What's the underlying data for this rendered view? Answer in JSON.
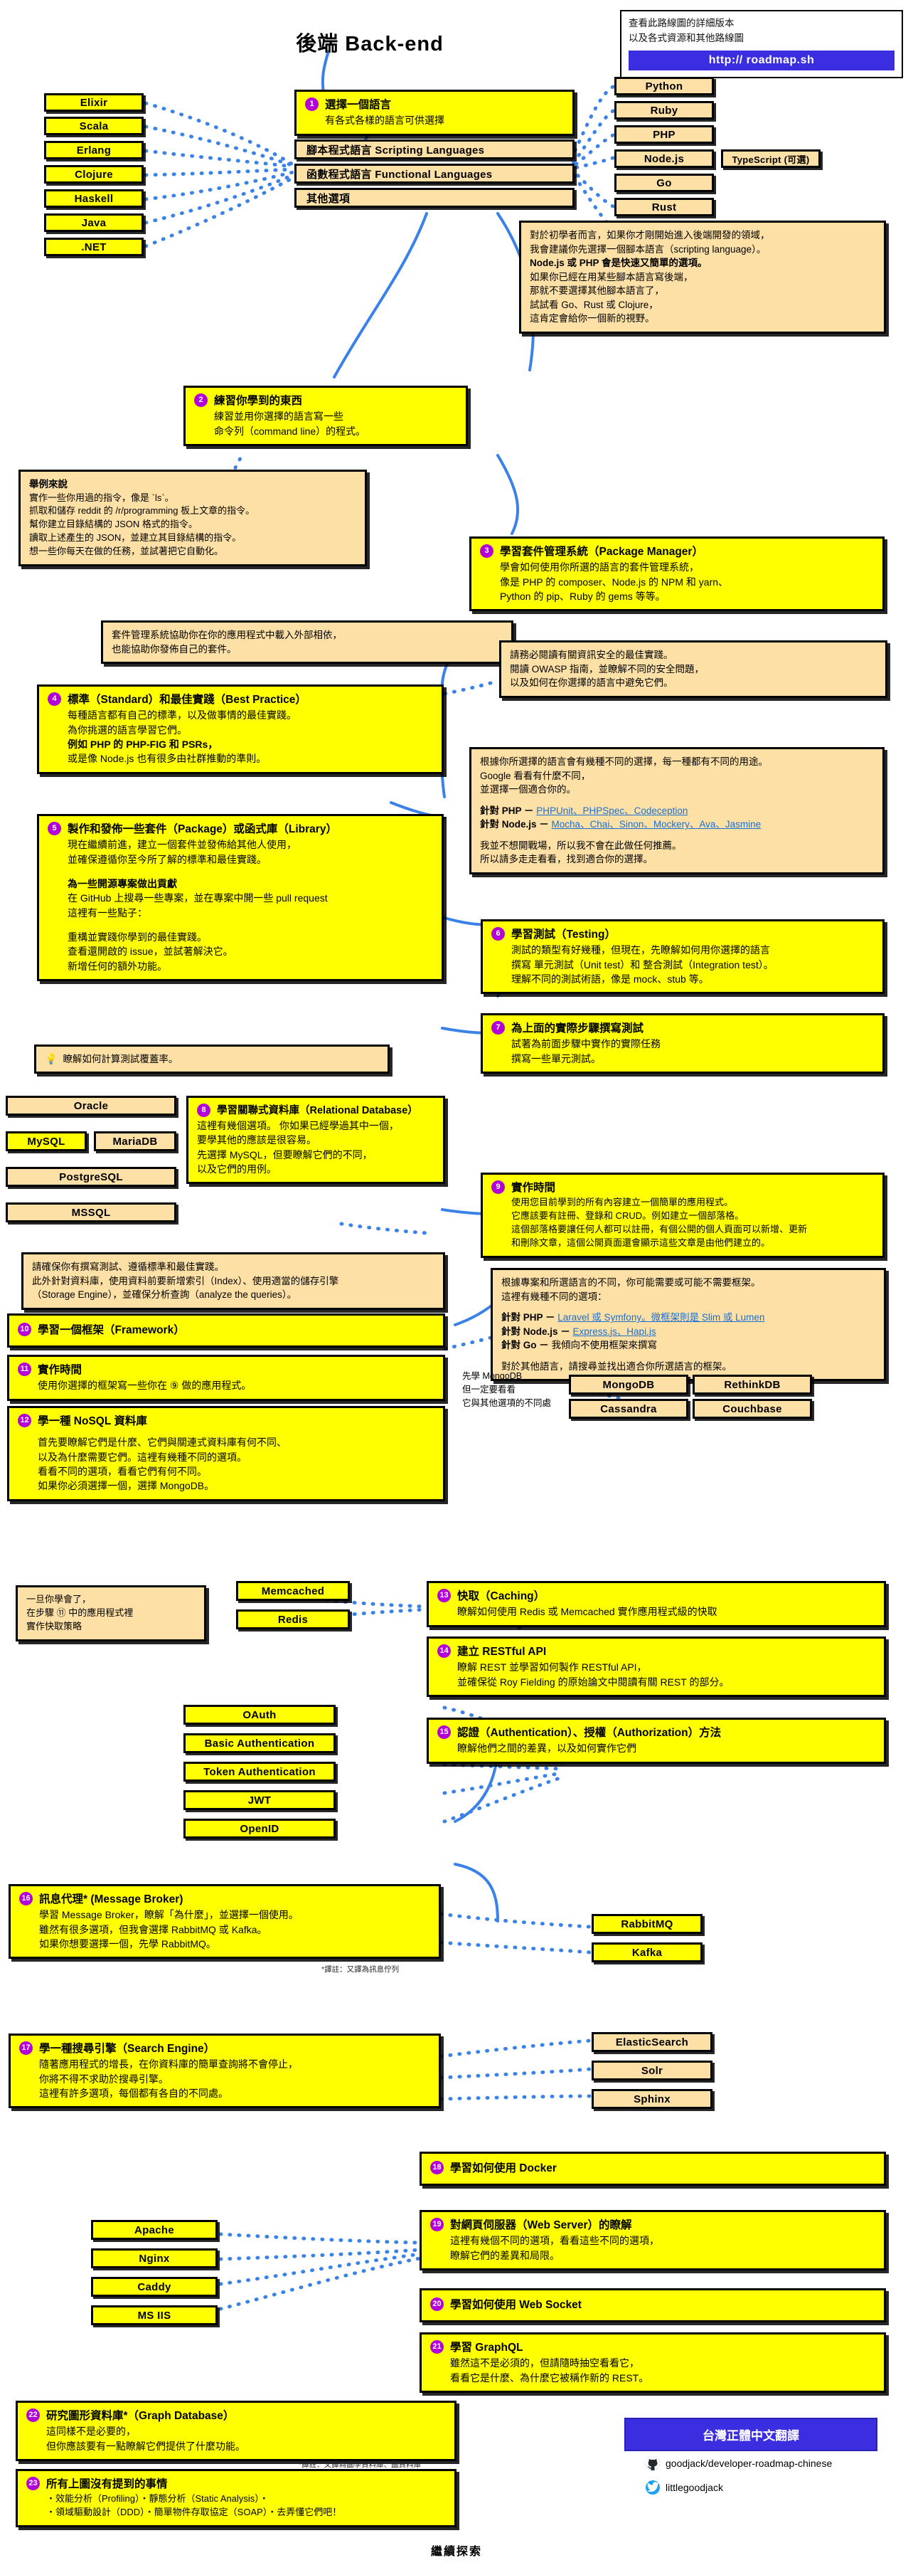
{
  "page": {
    "title": "後端 Back-end",
    "end_label": "繼續探索"
  },
  "url_card": {
    "line1": "查看此路線圖的詳細版本",
    "line2": "以及各式資源和其他路線圖",
    "button": "http:// roadmap.sh"
  },
  "languages_left": [
    "Elixir",
    "Scala",
    "Erlang",
    "Clojure",
    "Haskell",
    "Java",
    ".NET"
  ],
  "languages_right": [
    "Python",
    "Ruby",
    "PHP",
    "Node.js",
    "Go",
    "Rust"
  ],
  "typescript_note": "TypeScript (可選)",
  "lang_categories": [
    "腳本程式語言 Scripting Languages",
    "函數程式語言 Functional Languages",
    "其他選項"
  ],
  "steps": [
    {
      "num": "1",
      "title": "選擇一個語言",
      "lines": [
        "有各式各樣的語言可供選擇"
      ]
    },
    {
      "num": "2",
      "title": "練習你學到的東西",
      "lines": [
        "練習並用你選擇的語言寫一些",
        "命令列（command line）的程式。"
      ]
    },
    {
      "num": "3",
      "title": "學習套件管理系統（Package Manager）",
      "lines": [
        "學會如何使用你所選的語言的套件管理系統，",
        "像是 PHP 的 composer、Node.js 的 NPM 和 yarn、",
        "Python 的 pip、Ruby 的 gems 等等。"
      ]
    },
    {
      "num": "4",
      "title": "標準（Standard）和最佳實踐（Best Practice）",
      "lines": [
        "每種語言都有自己的標準，以及做事情的最佳實踐。",
        "為你挑選的語言學習它們。",
        "例如 PHP 的 PHP-FIG 和 PSRs，",
        "或是像 Node.js 也有很多由社群推動的準則。"
      ]
    },
    {
      "num": "5",
      "title": "製作和發佈一些套件（Package）或函式庫（Library）",
      "lines": [
        "現在繼續前進，建立一個套件並發佈給其他人使用，",
        "並確保遵循你至今所了解的標準和最佳實踐。"
      ],
      "subtitle": "為一些開源專案做出貢獻",
      "sublines": [
        "在 GitHub 上搜尋一些專案，並在專案中開一些 pull request",
        "這裡有一些點子："
      ],
      "sublines2": [
        "重構並實踐你學到的最佳實踐。",
        "查看還開啟的 issue，並試著解決它。",
        "新增任何的額外功能。"
      ]
    },
    {
      "num": "6",
      "title": "學習測試（Testing）",
      "lines": [
        "測試的類型有好幾種，但現在，先瞭解如何用你選擇的語言",
        "撰寫 單元測試（Unit test）和 整合測試（Integration test）。",
        "理解不同的測試術語，像是 mock、stub 等。"
      ]
    },
    {
      "num": "7",
      "title": "為上面的實際步驟撰寫測試",
      "lines": [
        "試著為前面步驟中實作的實際任務",
        "撰寫一些單元測試。"
      ]
    },
    {
      "num": "9",
      "title": "實作時間",
      "lines": [
        "使用您目前學到的所有內容建立一個簡單的應用程式。",
        "它應該要有註冊、登錄和 CRUD。例如建立一個部落格。",
        "這個部落格要讓任何人都可以註冊，有個公開的個人頁面可以新增、更新",
        "和刪除文章，這個公開頁面還會顯示這些文章是由他們建立的。"
      ]
    },
    {
      "num": "8",
      "title": "學習關聯式資料庫（Relational Database）",
      "lines": [
        "這裡有幾個選項。 你如果已經學過其中一個，",
        "要學其他的應該是很容易。",
        "先選擇 MySQL，但要瞭解它們的不同，",
        "以及它們的用例。"
      ]
    },
    {
      "num": "10",
      "title": "學習一個框架（Framework）",
      "lines": []
    },
    {
      "num": "11",
      "title": "實作時間",
      "lines": [
        "使用你選擇的框架寫一些你在 ⑨ 做的應用程式。"
      ]
    },
    {
      "num": "12",
      "title": "學一種 NoSQL 資料庫",
      "lines": [
        "首先要瞭解它們是什麼、它們與關連式資料庫有何不同、",
        "以及為什麼需要它們。這裡有幾種不同的選項。",
        "看看不同的選項，看看它們有何不同。",
        "如果你必須選擇一個，選擇 MongoDB。"
      ]
    },
    {
      "num": "13",
      "title": "快取（Caching）",
      "lines": [
        "瞭解如何使用 Redis 或 Memcached 實作應用程式級的快取"
      ]
    },
    {
      "num": "14",
      "title": "建立 RESTful API",
      "lines": [
        "瞭解 REST 並學習如何製作 RESTful API，",
        "並確保從 Roy Fielding 的原始論文中閱讀有關 REST 的部分。"
      ]
    },
    {
      "num": "15",
      "title": "認證（Authentication）、授權（Authorization）方法",
      "lines": [
        "瞭解他們之間的差異，以及如何實作它們"
      ]
    },
    {
      "num": "16",
      "title": "訊息代理* (Message Broker)",
      "lines": [
        "學習 Message Broker，瞭解「為什麼」，並選擇一個使用。",
        "雖然有很多選項，但我會選擇 RabbitMQ 或 Kafka。",
        "如果你想要選擇一個，先學 RabbitMQ。"
      ],
      "footnote": "*譯註：又譯為訊息佇列"
    },
    {
      "num": "17",
      "title": "學一種搜尋引擎（Search Engine）",
      "lines": [
        "隨著應用程式的增長，在你資料庫的簡單查詢將不會停止，",
        "你將不得不求助於搜尋引擎。",
        "這裡有許多選項，每個都有各自的不同處。"
      ],
      "footnote": "*譯註：又譯為圖學資料庫、圖資料庫"
    },
    {
      "num": "18",
      "title": "學習如何使用 Docker",
      "lines": []
    },
    {
      "num": "19",
      "title": "對網頁伺服器（Web Server）的瞭解",
      "lines": [
        "這裡有幾個不同的選項，看看這些不同的選項，",
        "瞭解它們的差異和局限。"
      ]
    },
    {
      "num": "20",
      "title": "學習如何使用 Web Socket",
      "lines": []
    },
    {
      "num": "21",
      "title": "學習 GraphQL",
      "lines": [
        "雖然這不是必須的，但請隨時抽空看看它，",
        "看看它是什麼、為什麼它被稱作新的 REST。"
      ]
    },
    {
      "num": "22",
      "title": "研究圖形資料庫*（Graph Database）",
      "lines": [
        "這同樣不是必要的，",
        "但你應該要有一點瞭解它們提供了什麼功能。"
      ],
      "footnote": "*譯註：又譯為圖學資料庫、圖資料庫"
    },
    {
      "num": "23",
      "title": "所有上圖沒有提到的事情",
      "lines": [
        "・效能分析（Profiling）・靜態分析（Static Analysis）・",
        "・領域驅動設計（DDD）・簡單物件存取協定（SOAP）・去弄懂它們吧！"
      ]
    }
  ],
  "notes": {
    "examples": {
      "title": "舉例來說",
      "lines": [
        "實作一些你用過的指令，像是 `ls`。",
        "抓取和儲存 reddit 的 /r/programming 板上文章的指令。",
        "幫你建立目錄結構的 JSON 格式的指令。",
        "讀取上述產生的 JSON，並建立其目錄結構的指令。",
        "想一些你每天在做的任務，並試著把它自動化。"
      ]
    },
    "beginner": [
      "對於初學者而言，如果你才剛開始進入後端開發的領域，",
      "我會建議你先選擇一個腳本語言（scripting language）。",
      "Node.js 或 PHP 會是快速又簡單的選項。",
      "如果你已經在用某些腳本語言寫後端，",
      "那就不要選擇其他腳本語言了，",
      "試試看 Go、Rust 或 Clojure，",
      "這肯定會給你一個新的視野。"
    ],
    "package_manager": [
      "套件管理系統協助你在你的應用程式中載入外部相依，",
      "也能協助你發佈自己的套件。"
    ],
    "owasp": [
      "請務必閱讀有關資訊安全的最佳實踐。",
      "閱讀 OWASP 指南，並瞭解不同的安全問題，",
      "以及如何在你選擇的語言中避免它們。"
    ],
    "testing_options": {
      "lines": [
        "根據你所選擇的語言會有幾種不同的選擇，每一種都有不同的用途。",
        "Google 看看有什麼不同，",
        "並選擇一個適合你的。"
      ],
      "php_label": "針對 PHP －",
      "php_items": "PHPUnit、PHPSpec、Codeception",
      "node_label": "針對 Node.js －",
      "node_items": "Mocha、Chai、Sinon、Mockery、Ava、Jasmine",
      "tail": [
        "我並不想開戰場，所以我不會在此做任何推薦。",
        "所以請多走走看看，找到適合你的選擇。"
      ]
    },
    "coverage": "瞭解如何計算測試覆蓋率。",
    "db_practice": [
      "請確保你有撰寫測試、遵循標準和最佳實踐。",
      "此外針對資料庫，使用資料前要新增索引（Index）、使用適當的儲存引擎",
      "（Storage Engine），並確保分析查詢（analyze the queries）。"
    ],
    "framework_options": {
      "lines": [
        "根據專案和所選語言的不同，你可能需要或可能不需要框架。",
        "這裡有幾種不同的選項："
      ],
      "php_label": "針對 PHP －",
      "php_items": "Laravel 或 Symfony。微框架則是 Slim 或 Lumen",
      "node_label": "針對 Node.js －",
      "node_items": "Express.js、Hapi.js",
      "go_label": "針對 Go －",
      "go_items": "我傾向不使用框架來撰寫",
      "tail": [
        "對於其他語言，請搜尋並找出適合你所選語言的框架。"
      ]
    },
    "mongo_note": [
      "先學 MongoDB",
      "但一定要看看",
      "它與其他選項的不同處"
    ],
    "cache_note": [
      "一旦你學會了，",
      "在步驟 ⑪ 中的應用程式裡",
      "實作快取策略"
    ]
  },
  "boxes": {
    "relational_db": [
      "Oracle",
      "MySQL",
      "MariaDB",
      "PostgreSQL",
      "MSSQL"
    ],
    "nosql_db": [
      "MongoDB",
      "RethinkDB",
      "Cassandra",
      "Couchbase"
    ],
    "cache": [
      "Memcached",
      "Redis"
    ],
    "auth": [
      "OAuth",
      "Basic Authentication",
      "Token Authentication",
      "JWT",
      "OpenID"
    ],
    "broker": [
      "RabbitMQ",
      "Kafka"
    ],
    "search": [
      "ElasticSearch",
      "Solr",
      "Sphinx"
    ],
    "webserver": [
      "Apache",
      "Nginx",
      "Caddy",
      "MS IIS"
    ]
  },
  "footer": {
    "translate_button": "台灣正體中文翻譯",
    "github": "goodjack/developer-roadmap-chinese",
    "twitter": "littlegoodjack"
  }
}
